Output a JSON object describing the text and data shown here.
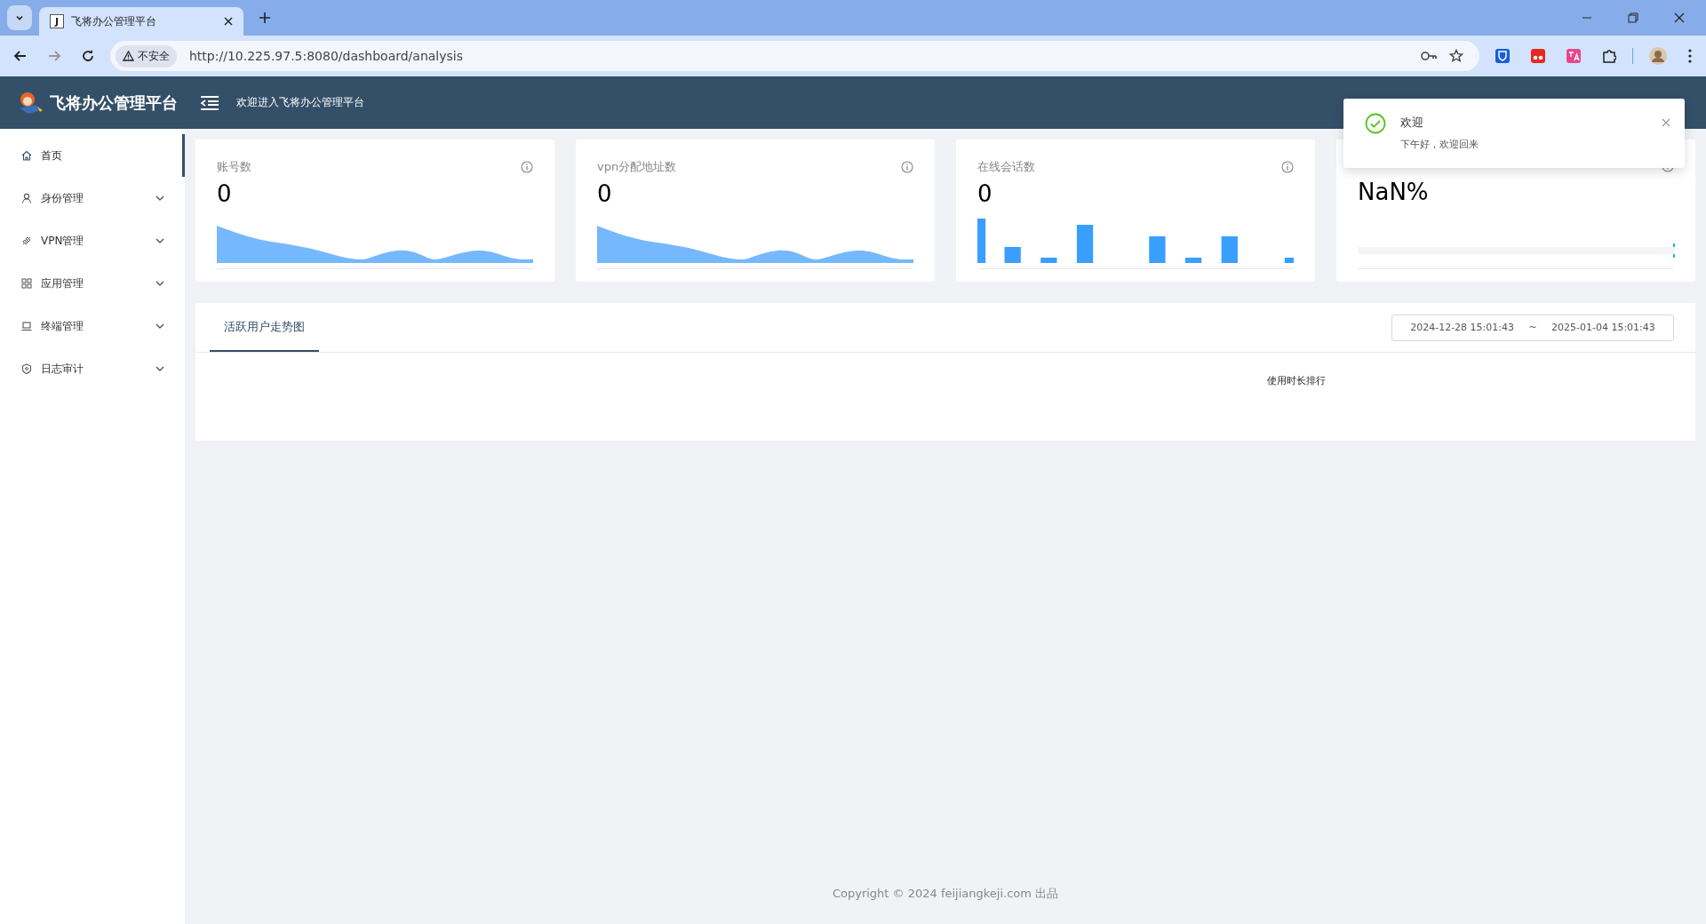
{
  "browser": {
    "tabs": [
      {
        "title": "飞将办公管理平台",
        "favicon": "J",
        "selected": true
      }
    ],
    "security_label": "不安全",
    "url": "http://10.225.97.5:8080/dashboard/analysis"
  },
  "header": {
    "logo_text": "飞将办公管理平台",
    "welcome": "欢迎进入飞将办公管理平台"
  },
  "sidebar": {
    "items": [
      {
        "label": "首页",
        "selected": true,
        "expandable": false
      },
      {
        "label": "身份管理",
        "selected": false,
        "expandable": true
      },
      {
        "label": "VPN管理",
        "selected": false,
        "expandable": true
      },
      {
        "label": "应用管理",
        "selected": false,
        "expandable": true
      },
      {
        "label": "终端管理",
        "selected": false,
        "expandable": true
      },
      {
        "label": "日志审计",
        "selected": false,
        "expandable": true
      }
    ]
  },
  "stat_cards": [
    {
      "title": "账号数",
      "value": "0",
      "kind": "area"
    },
    {
      "title": "vpn分配地址数",
      "value": "0",
      "kind": "area"
    },
    {
      "title": "在线会话数",
      "value": "0",
      "kind": "bar"
    },
    {
      "value": "NaN%",
      "kind": "progress",
      "level": 0
    }
  ],
  "panel": {
    "tabs": [
      {
        "label": "活跃用户走势图",
        "selected": true
      }
    ],
    "date_range": {
      "start": "2024-12-28 15:01:43",
      "separator": "~",
      "end": "2025-01-04 15:01:43"
    },
    "ranking_title": "使用时长排行"
  },
  "toast": {
    "title": "欢迎",
    "message": "下午好，欢迎回来"
  },
  "footer": "Copyright © 2024 feijiangkeji.com 出品"
}
